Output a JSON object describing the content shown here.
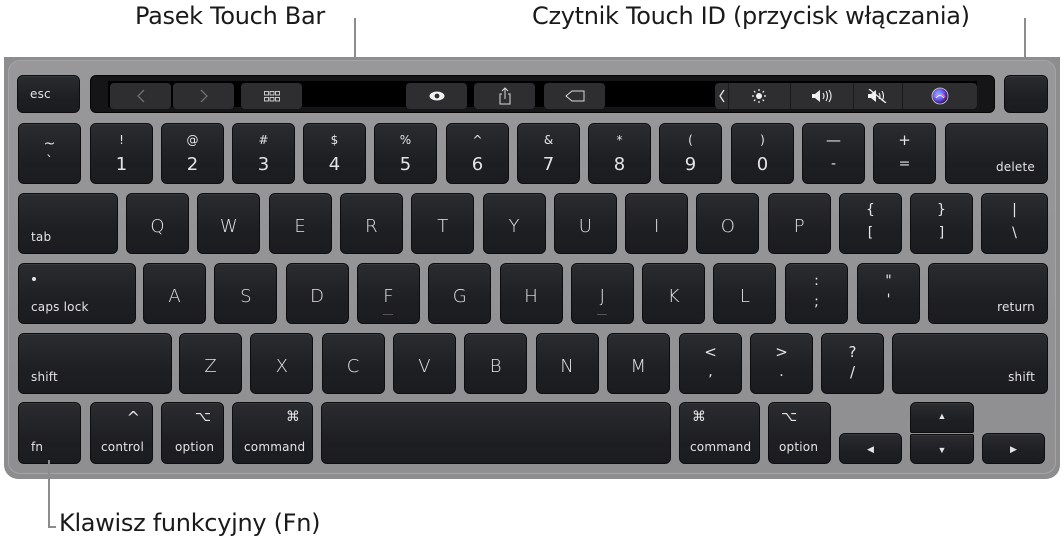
{
  "callouts": {
    "touch_bar": "Pasek Touch Bar",
    "touch_id": "Czytnik Touch ID (przycisk włączania)",
    "fn_key": "Klawisz funkcyjny (Fn)"
  },
  "touch_bar": {
    "buttons": [
      {
        "name": "back",
        "glyph": "‹"
      },
      {
        "name": "forward",
        "glyph": "›"
      },
      {
        "name": "tab-overview",
        "glyph": "▫▫▫"
      },
      {
        "name": "view",
        "glyph": "👁"
      },
      {
        "name": "share",
        "glyph": "⇪"
      },
      {
        "name": "tag",
        "glyph": "⌂"
      }
    ],
    "control_strip": [
      {
        "name": "collapse",
        "glyph": "‹"
      },
      {
        "name": "brightness",
        "glyph": "☼"
      },
      {
        "name": "volume",
        "glyph": "🔊"
      },
      {
        "name": "mute",
        "glyph": "🔇"
      },
      {
        "name": "siri",
        "glyph": "●"
      }
    ]
  },
  "keys": {
    "esc": "esc",
    "number_row": [
      {
        "top": "~",
        "bottom": "`"
      },
      {
        "top": "!",
        "bottom": "1"
      },
      {
        "top": "@",
        "bottom": "2"
      },
      {
        "top": "#",
        "bottom": "3"
      },
      {
        "top": "$",
        "bottom": "4"
      },
      {
        "top": "%",
        "bottom": "5"
      },
      {
        "top": "^",
        "bottom": "6"
      },
      {
        "top": "&",
        "bottom": "7"
      },
      {
        "top": "*",
        "bottom": "8"
      },
      {
        "top": "(",
        "bottom": "9"
      },
      {
        "top": ")",
        "bottom": "0"
      },
      {
        "top": "—",
        "bottom": "-"
      },
      {
        "top": "+",
        "bottom": "="
      }
    ],
    "delete": "delete",
    "tab": "tab",
    "qwerty_row": [
      "Q",
      "W",
      "E",
      "R",
      "T",
      "Y",
      "U",
      "I",
      "O",
      "P"
    ],
    "bracket_left": {
      "top": "{",
      "bottom": "["
    },
    "bracket_right": {
      "top": "}",
      "bottom": "]"
    },
    "backslash": {
      "top": "|",
      "bottom": "\\"
    },
    "caps_lock": "caps lock",
    "home_row": [
      "A",
      "S",
      "D",
      "F",
      "G",
      "H",
      "J",
      "K",
      "L"
    ],
    "semicolon": {
      "top": ":",
      "bottom": ";"
    },
    "quote": {
      "top": "\"",
      "bottom": "'"
    },
    "return": "return",
    "shift": "shift",
    "bottom_letters": [
      "Z",
      "X",
      "C",
      "V",
      "B",
      "N",
      "M"
    ],
    "comma": {
      "top": "<",
      "bottom": ","
    },
    "period": {
      "top": ">",
      "bottom": "."
    },
    "slash": {
      "top": "?",
      "bottom": "/"
    },
    "fn": "fn",
    "control": {
      "label": "control",
      "symbol": "^"
    },
    "option": {
      "label": "option",
      "symbol": "⌥"
    },
    "command": {
      "label": "command",
      "symbol": "⌘"
    },
    "arrows": {
      "left": "◀",
      "up": "▲",
      "down": "▼",
      "right": "▶"
    }
  }
}
